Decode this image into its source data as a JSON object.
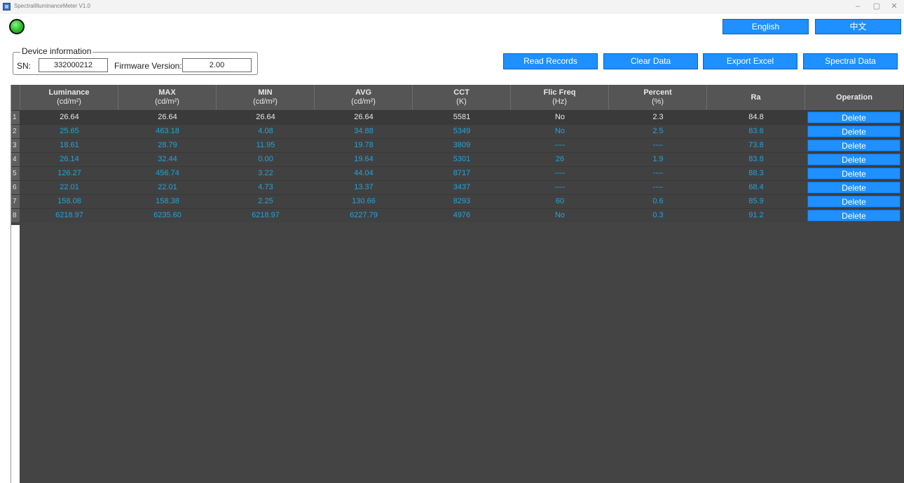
{
  "window": {
    "title": "SpectralIlluminanceMeter V1.0",
    "minimize": "–",
    "maximize": "▢",
    "close": "✕"
  },
  "language": {
    "english": "English",
    "chinese": "中文"
  },
  "device": {
    "legend": "Device information",
    "sn_label": "SN:",
    "sn_value": "332000212",
    "fw_label": "Firmware Version:",
    "fw_value": "2.00"
  },
  "actions": {
    "read_records": "Read Records",
    "clear_data": "Clear Data",
    "export_excel": "Export Excel",
    "spectral_data": "Spectral Data"
  },
  "table": {
    "headers": [
      {
        "name": "Luminance",
        "unit": "(cd/m²)"
      },
      {
        "name": "MAX",
        "unit": "(cd/m²)"
      },
      {
        "name": "MIN",
        "unit": "(cd/m²)"
      },
      {
        "name": "AVG",
        "unit": "(cd/m²)"
      },
      {
        "name": "CCT",
        "unit": "(K)"
      },
      {
        "name": "Flic Freq",
        "unit": "(Hz)"
      },
      {
        "name": "Percent",
        "unit": "(%)"
      },
      {
        "name": "Ra",
        "unit": ""
      },
      {
        "name": "Operation",
        "unit": ""
      }
    ],
    "delete_label": "Delete",
    "rows": [
      {
        "num": "1",
        "cells": [
          "26.64",
          "26.64",
          "26.64",
          "26.64",
          "5581",
          "No",
          "2.3",
          "84.8"
        ]
      },
      {
        "num": "2",
        "cells": [
          "25.65",
          "463.18",
          "4.08",
          "34.88",
          "5349",
          "No",
          "2.5",
          "83.6"
        ]
      },
      {
        "num": "3",
        "cells": [
          "18.61",
          "28.79",
          "11.95",
          "19.78",
          "3809",
          "----",
          "----",
          "73.8"
        ]
      },
      {
        "num": "4",
        "cells": [
          "26.14",
          "32.44",
          "0.00",
          "19.64",
          "5301",
          "26",
          "1.9",
          "83.8"
        ]
      },
      {
        "num": "5",
        "cells": [
          "126.27",
          "456.74",
          "3.22",
          "44.04",
          "8717",
          "----",
          "----",
          "88.3"
        ]
      },
      {
        "num": "6",
        "cells": [
          "22.01",
          "22.01",
          "4.73",
          "13.37",
          "3437",
          "----",
          "----",
          "68.4"
        ]
      },
      {
        "num": "7",
        "cells": [
          "158.08",
          "158.38",
          "2.25",
          "130.66",
          "8293",
          "60",
          "0.6",
          "85.9"
        ]
      },
      {
        "num": "8",
        "cells": [
          "6218.97",
          "6235.60",
          "6218.97",
          "6227.79",
          "4976",
          "No",
          "0.3",
          "91.2"
        ]
      }
    ]
  }
}
